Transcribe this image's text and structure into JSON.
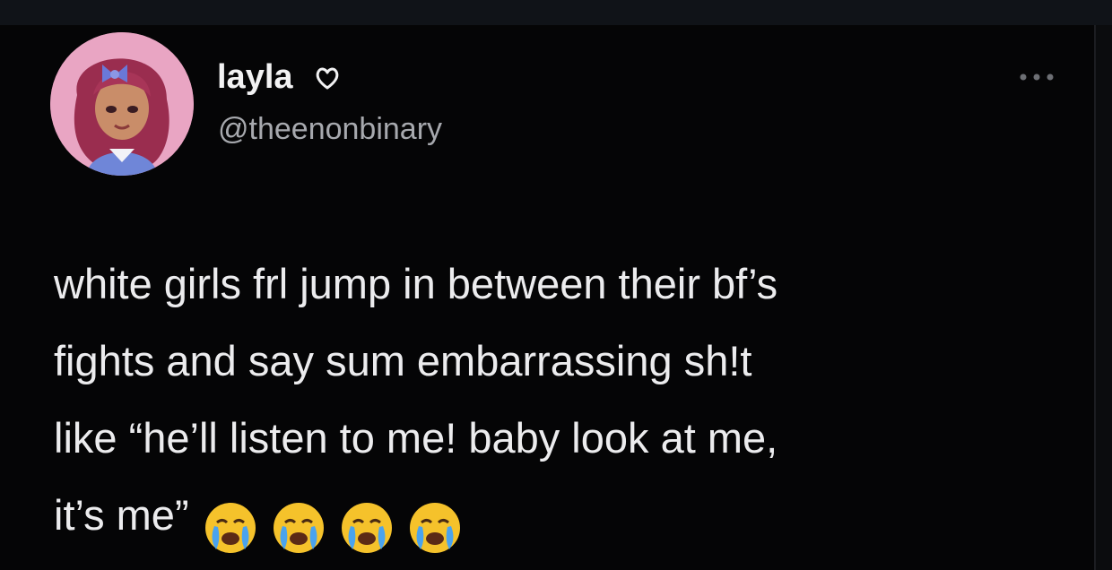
{
  "tweet": {
    "author": {
      "display_name": "layla",
      "handle": "@theenonbinary",
      "badge_icon": "heart-outline-icon"
    },
    "menu_icon": "more-options-icon",
    "text_lines": [
      "white girls frl jump in between their bf’s",
      "fights and say sum embarrassing sh!t",
      "like “he’ll listen to me! baby look at me,",
      "it’s me”"
    ],
    "emoji": [
      "😭",
      "😭",
      "😭",
      "😭"
    ],
    "emoji_icon": "loudly-crying-face-icon"
  },
  "colors": {
    "background": "#050506",
    "text_primary": "#ececee",
    "text_secondary": "#a7a9ae",
    "emoji_yellow": "#f5c22b",
    "tear_blue": "#4aa3ee"
  }
}
